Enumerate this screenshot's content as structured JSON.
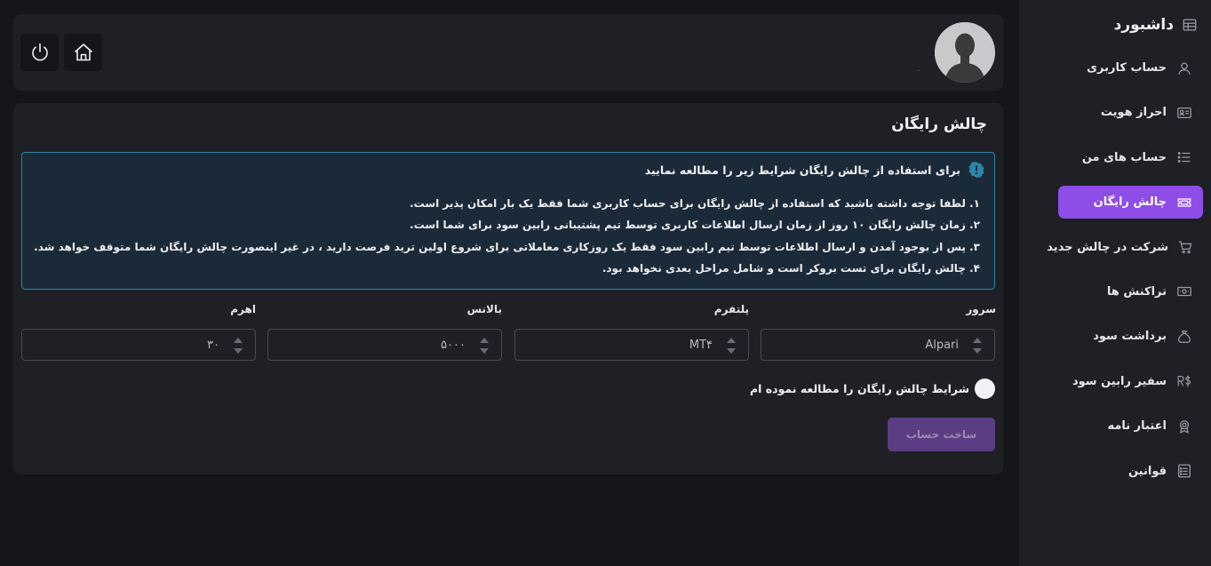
{
  "sidebar": {
    "brand": {
      "title": "داشبورد",
      "icon": "dashboard-grid-icon"
    },
    "items": [
      {
        "label": "حساب کاربری",
        "icon": "user-icon",
        "active": false
      },
      {
        "label": "احراز هویت",
        "icon": "id-card-icon",
        "active": false
      },
      {
        "label": "حساب های من",
        "icon": "list-icon",
        "active": false
      },
      {
        "label": "چالش رایگان",
        "icon": "ticket-icon",
        "active": true
      },
      {
        "label": "شرکت در چالش جدید",
        "icon": "cart-icon",
        "active": false
      },
      {
        "label": "تراکنش ها",
        "icon": "banknote-icon",
        "active": false
      },
      {
        "label": "برداشت سود",
        "icon": "money-bag-icon",
        "active": false
      },
      {
        "label": "سفیر رابین سود",
        "icon": "r-dollar-icon",
        "active": false
      },
      {
        "label": "اعتبار نامه",
        "icon": "award-icon",
        "active": false
      },
      {
        "label": "قوانین",
        "icon": "rules-list-icon",
        "active": false
      }
    ]
  },
  "header": {
    "username": ".",
    "home_icon": "home-icon",
    "power_icon": "power-icon",
    "avatar_icon": "user-avatar-icon"
  },
  "main": {
    "title": "چالش رایگان",
    "notice": {
      "heading": "برای استفاده از چالش رایگان شرایط زیر را مطالعه نمایید",
      "icon": "info-badge-icon",
      "lines": [
        "۱. لطفا توجه داشته باشید که استفاده از چالش رایگان برای حساب کاربری شما فقط یک بار امکان پذیر است.",
        "۲. زمان چالش رایگان ۱۰ روز از زمان ارسال اطلاعات کاربری توسط تیم پشتیبانی رابین سود برای شما است.",
        "۳. پس از بوجود آمدن و ارسال اطلاعات توسط تیم رابین سود فقط یک روزکاری معاملاتی برای شروع اولین ترید فرصت دارید ، در غیر اینصورت چالش رایگان شما متوقف خواهد شد.",
        "۴. چالش رایگان برای تست بروکر است و شامل مراحل بعدی نخواهد بود."
      ]
    },
    "fields": {
      "server": {
        "label": "سرور",
        "value": "Alpari"
      },
      "platform": {
        "label": "پلتفرم",
        "value": "MT۴"
      },
      "balance": {
        "label": "بالانس",
        "value": "۵۰۰۰"
      },
      "leverage": {
        "label": "اهرم",
        "value": "۳۰"
      }
    },
    "agree_label": "شرایط چالش رایگان را مطالعه نموده ام",
    "create_button": "ساخت حساب"
  },
  "colors": {
    "background": "#15161a",
    "card": "#1f2025",
    "accent": "#8e4de6",
    "notice_border": "#2c86a8",
    "button_disabled": "#5a3d82"
  }
}
